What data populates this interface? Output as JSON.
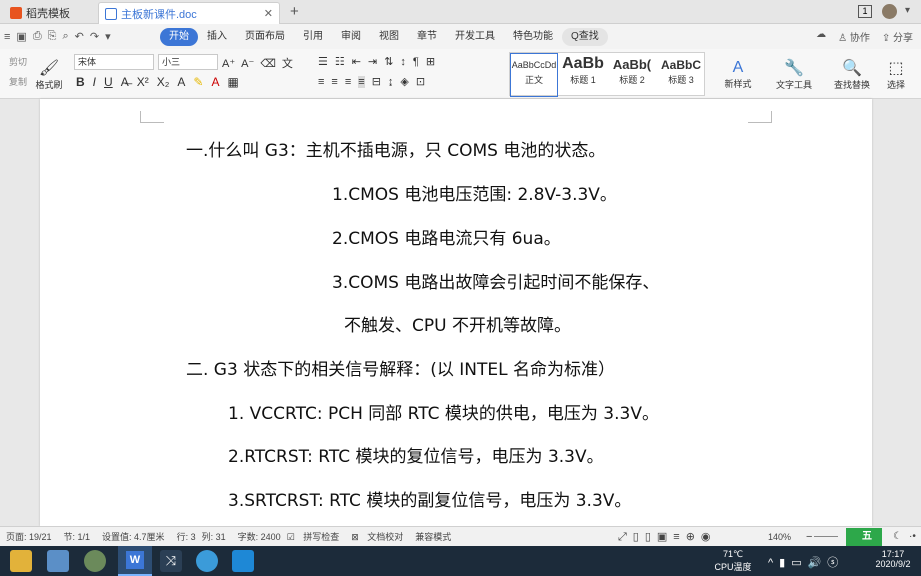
{
  "tabs": [
    {
      "label": "稻壳模板",
      "color": "#e8541f"
    },
    {
      "label": "主板新课件.doc",
      "color": "#3c76d6"
    }
  ],
  "new_tab_symbol": "+",
  "window_badge": "1",
  "menu": {
    "start_label": "开始",
    "items": [
      "插入",
      "页面布局",
      "引用",
      "审阅",
      "视图",
      "章节",
      "开发工具",
      "特色功能"
    ],
    "search_label": "Q查找",
    "collab_label": "协作",
    "share_label": "分享"
  },
  "ribbon": {
    "cut_label": "剪切",
    "copy_label": "复制",
    "paste_label": "粘贴",
    "format_painter_label": "格式刷",
    "font_name": "宋体",
    "font_size": "小三",
    "bold": "B",
    "italic": "I",
    "underline": "U",
    "styles": [
      {
        "sample": "AaBbCcDd",
        "label": "正文"
      },
      {
        "sample": "AaBb",
        "label": "标题 1"
      },
      {
        "sample": "AaBb(",
        "label": "标题 2"
      },
      {
        "sample": "AaBbC",
        "label": "标题 3"
      }
    ],
    "new_style_label": "新样式",
    "text_tools_label": "文字工具",
    "find_replace_label": "查找替换",
    "select_label": "选择"
  },
  "document": {
    "lines": [
      "一.什么叫 G3：主机不插电源，只 COMS 电池的状态。",
      "1.CMOS 电池电压范围: 2.8V-3.3V。",
      "2.CMOS 电路电流只有 6ua。",
      "3.COMS 电路出故障会引起时间不能保存、",
      "不触发、CPU 不开机等故障。",
      "二. G3 状态下的相关信号解释：(以 INTEL 名命为标准）",
      "1. VCCRTC:    PCH 同部 RTC 模块的供电，电压为 3.3V。",
      "2.RTCRST:      RTC 模块的复位信号，电压为 3.3V。",
      "3.SRTCRST:    RTC 模块的副复位信号，电压为 3.3V。"
    ]
  },
  "status": {
    "page": "页面: 19/21",
    "section": "节: 1/1",
    "setting": "设置值: 4.7厘米",
    "row": "行: 3",
    "col": "列: 31",
    "word_count": "字数: 2400",
    "spell_check": "拼写检查",
    "doc_check": "文档校对",
    "compat_mode": "兼容模式",
    "zoom": "140%",
    "minus": "−",
    "plus": "+",
    "ime": "五"
  },
  "taskbar": {
    "cpu_temp": "71℃",
    "cpu_label": "CPU温度",
    "time": "17:17",
    "date": "2020/9/2"
  }
}
